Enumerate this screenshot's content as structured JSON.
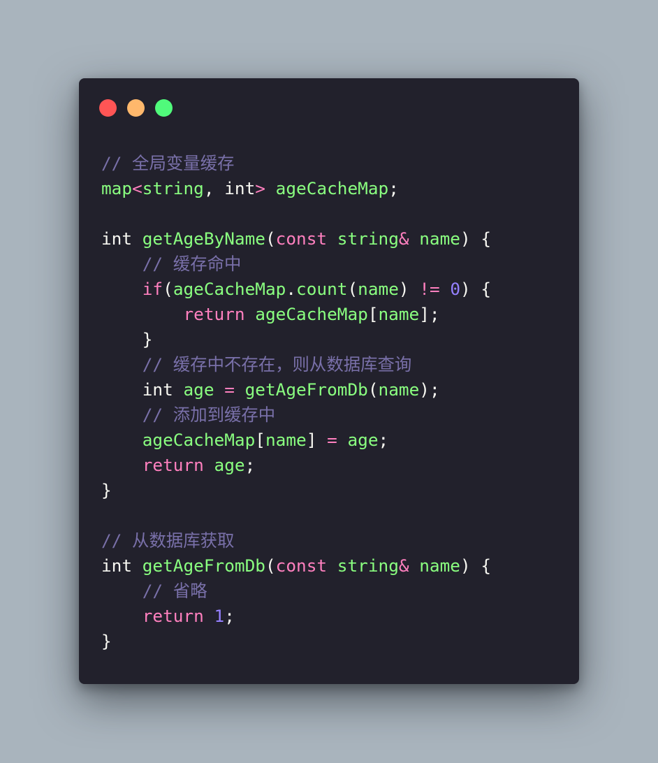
{
  "window": {
    "controls": [
      {
        "name": "close-button",
        "color": "#ff5555"
      },
      {
        "name": "minimize-button",
        "color": "#ffb86c"
      },
      {
        "name": "maximize-button",
        "color": "#50fa7b"
      }
    ]
  },
  "code": {
    "lines": [
      [
        {
          "t": "// 全局变量缓存",
          "c": "comment"
        }
      ],
      [
        {
          "t": "map",
          "c": "type"
        },
        {
          "t": "<",
          "c": "keyword"
        },
        {
          "t": "string",
          "c": "type"
        },
        {
          "t": ", ",
          "c": "punct"
        },
        {
          "t": "int",
          "c": "plain"
        },
        {
          "t": "> ",
          "c": "keyword"
        },
        {
          "t": "ageCacheMap",
          "c": "function"
        },
        {
          "t": ";",
          "c": "punct"
        }
      ],
      [],
      [
        {
          "t": "int ",
          "c": "plain"
        },
        {
          "t": "getAgeByName",
          "c": "function"
        },
        {
          "t": "(",
          "c": "punct"
        },
        {
          "t": "const ",
          "c": "keyword"
        },
        {
          "t": "string",
          "c": "type"
        },
        {
          "t": "& ",
          "c": "keyword"
        },
        {
          "t": "name",
          "c": "function"
        },
        {
          "t": ") {",
          "c": "punct"
        }
      ],
      [
        {
          "t": "    ",
          "c": "plain"
        },
        {
          "t": "// 缓存命中",
          "c": "comment"
        }
      ],
      [
        {
          "t": "    ",
          "c": "plain"
        },
        {
          "t": "if",
          "c": "keyword"
        },
        {
          "t": "(",
          "c": "punct"
        },
        {
          "t": "ageCacheMap",
          "c": "function"
        },
        {
          "t": ".",
          "c": "punct"
        },
        {
          "t": "count",
          "c": "function"
        },
        {
          "t": "(",
          "c": "punct"
        },
        {
          "t": "name",
          "c": "function"
        },
        {
          "t": ") ",
          "c": "punct"
        },
        {
          "t": "!= ",
          "c": "keyword"
        },
        {
          "t": "0",
          "c": "number"
        },
        {
          "t": ") {",
          "c": "punct"
        }
      ],
      [
        {
          "t": "        ",
          "c": "plain"
        },
        {
          "t": "return ",
          "c": "keyword"
        },
        {
          "t": "ageCacheMap",
          "c": "function"
        },
        {
          "t": "[",
          "c": "punct"
        },
        {
          "t": "name",
          "c": "function"
        },
        {
          "t": "];",
          "c": "punct"
        }
      ],
      [
        {
          "t": "    }",
          "c": "punct"
        }
      ],
      [
        {
          "t": "    ",
          "c": "plain"
        },
        {
          "t": "// 缓存中不存在，则从数据库查询",
          "c": "comment"
        }
      ],
      [
        {
          "t": "    ",
          "c": "plain"
        },
        {
          "t": "int ",
          "c": "plain"
        },
        {
          "t": "age ",
          "c": "function"
        },
        {
          "t": "= ",
          "c": "keyword"
        },
        {
          "t": "getAgeFromDb",
          "c": "function"
        },
        {
          "t": "(",
          "c": "punct"
        },
        {
          "t": "name",
          "c": "function"
        },
        {
          "t": ");",
          "c": "punct"
        }
      ],
      [
        {
          "t": "    ",
          "c": "plain"
        },
        {
          "t": "// 添加到缓存中",
          "c": "comment"
        }
      ],
      [
        {
          "t": "    ",
          "c": "plain"
        },
        {
          "t": "ageCacheMap",
          "c": "function"
        },
        {
          "t": "[",
          "c": "punct"
        },
        {
          "t": "name",
          "c": "function"
        },
        {
          "t": "] ",
          "c": "punct"
        },
        {
          "t": "= ",
          "c": "keyword"
        },
        {
          "t": "age",
          "c": "function"
        },
        {
          "t": ";",
          "c": "punct"
        }
      ],
      [
        {
          "t": "    ",
          "c": "plain"
        },
        {
          "t": "return ",
          "c": "keyword"
        },
        {
          "t": "age",
          "c": "function"
        },
        {
          "t": ";",
          "c": "punct"
        }
      ],
      [
        {
          "t": "}",
          "c": "punct"
        }
      ],
      [],
      [
        {
          "t": "// 从数据库获取",
          "c": "comment"
        }
      ],
      [
        {
          "t": "int ",
          "c": "plain"
        },
        {
          "t": "getAgeFromDb",
          "c": "function"
        },
        {
          "t": "(",
          "c": "punct"
        },
        {
          "t": "const ",
          "c": "keyword"
        },
        {
          "t": "string",
          "c": "type"
        },
        {
          "t": "& ",
          "c": "keyword"
        },
        {
          "t": "name",
          "c": "function"
        },
        {
          "t": ") {",
          "c": "punct"
        }
      ],
      [
        {
          "t": "    ",
          "c": "plain"
        },
        {
          "t": "// 省略",
          "c": "comment"
        }
      ],
      [
        {
          "t": "    ",
          "c": "plain"
        },
        {
          "t": "return ",
          "c": "keyword"
        },
        {
          "t": "1",
          "c": "number"
        },
        {
          "t": ";",
          "c": "punct"
        }
      ],
      [
        {
          "t": "}",
          "c": "punct"
        }
      ]
    ]
  }
}
